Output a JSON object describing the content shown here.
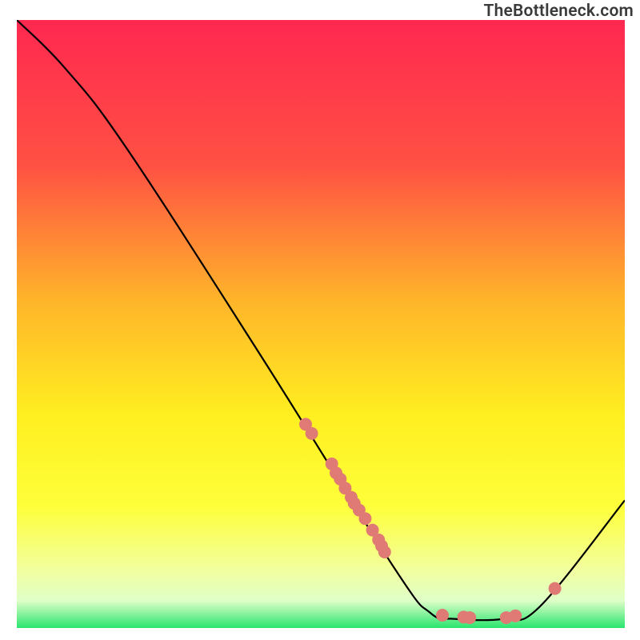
{
  "attribution": "TheBottleneck.com",
  "chart_data": {
    "type": "line",
    "title": "",
    "xlabel": "",
    "ylabel": "",
    "xlim": [
      0,
      100
    ],
    "ylim": [
      0,
      100
    ],
    "curve": [
      {
        "x": 0,
        "y": 100
      },
      {
        "x": 8,
        "y": 92
      },
      {
        "x": 18,
        "y": 79
      },
      {
        "x": 40,
        "y": 45
      },
      {
        "x": 62,
        "y": 10
      },
      {
        "x": 68,
        "y": 2.5
      },
      {
        "x": 72,
        "y": 1.5
      },
      {
        "x": 80,
        "y": 1.5
      },
      {
        "x": 86,
        "y": 3.5
      },
      {
        "x": 100,
        "y": 21
      }
    ],
    "dots": [
      {
        "x": 47.5,
        "y": 33.5
      },
      {
        "x": 48.5,
        "y": 32.0
      },
      {
        "x": 51.8,
        "y": 27.0
      },
      {
        "x": 52.5,
        "y": 25.5
      },
      {
        "x": 53.2,
        "y": 24.5
      },
      {
        "x": 54.0,
        "y": 23.0
      },
      {
        "x": 55.0,
        "y": 21.5
      },
      {
        "x": 55.5,
        "y": 20.5
      },
      {
        "x": 56.3,
        "y": 19.4
      },
      {
        "x": 57.3,
        "y": 18.0
      },
      {
        "x": 58.5,
        "y": 16.1
      },
      {
        "x": 59.5,
        "y": 14.5
      },
      {
        "x": 60.0,
        "y": 13.5
      },
      {
        "x": 60.5,
        "y": 12.5
      },
      {
        "x": 70.0,
        "y": 2.1
      },
      {
        "x": 73.5,
        "y": 1.8
      },
      {
        "x": 74.5,
        "y": 1.7
      },
      {
        "x": 80.5,
        "y": 1.7
      },
      {
        "x": 82.0,
        "y": 2.0
      },
      {
        "x": 88.5,
        "y": 6.5
      }
    ],
    "gradient_stops": [
      {
        "pct": 0,
        "color": "#ff2850"
      },
      {
        "pct": 24,
        "color": "#ff5143"
      },
      {
        "pct": 46,
        "color": "#ffb42a"
      },
      {
        "pct": 65,
        "color": "#ffef20"
      },
      {
        "pct": 80,
        "color": "#feff3a"
      },
      {
        "pct": 90,
        "color": "#f3ff9a"
      },
      {
        "pct": 95.5,
        "color": "#dfffc8"
      },
      {
        "pct": 100,
        "color": "#29e56e"
      }
    ],
    "dot_radius_pct": 1.05
  }
}
